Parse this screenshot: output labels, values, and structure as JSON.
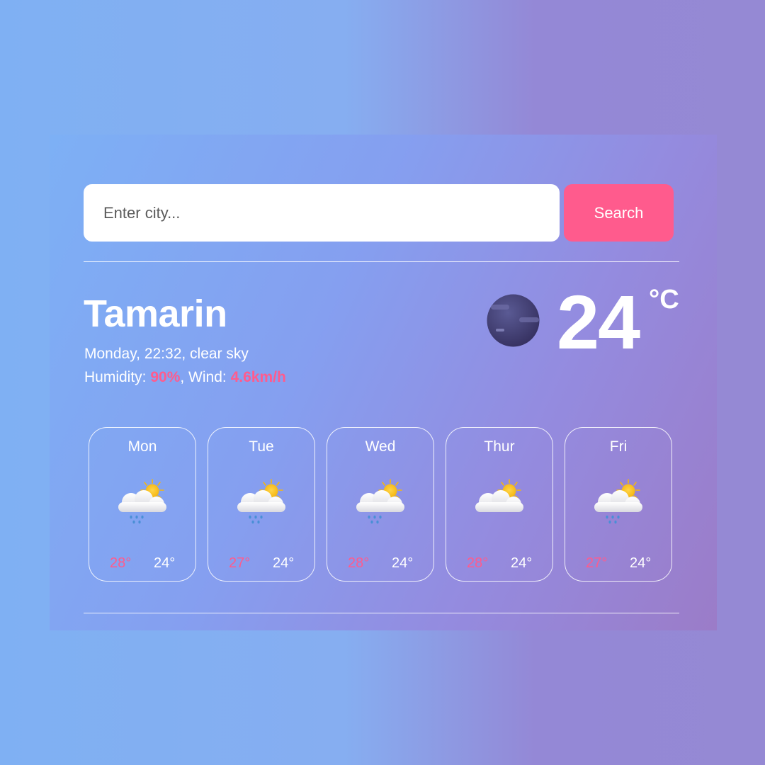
{
  "search": {
    "placeholder": "Enter city...",
    "value": "",
    "button_label": "Search"
  },
  "current": {
    "city": "Tamarin",
    "day_time_description": "Monday, 22:32, clear sky",
    "humidity_label": "Humidity: ",
    "humidity_value": "90%",
    "wind_label": ", Wind: ",
    "wind_value": "4.6km/h",
    "temperature": "24",
    "unit": "°C",
    "icon": "night-clear-moon-icon"
  },
  "forecast": [
    {
      "day": "Mon",
      "icon": "rain-cloud-sun-icon",
      "high": "28°",
      "low": "24°"
    },
    {
      "day": "Tue",
      "icon": "rain-cloud-sun-icon",
      "high": "27°",
      "low": "24°"
    },
    {
      "day": "Wed",
      "icon": "rain-cloud-sun-icon",
      "high": "28°",
      "low": "24°"
    },
    {
      "day": "Thur",
      "icon": "cloud-sun-icon",
      "high": "28°",
      "low": "24°"
    },
    {
      "day": "Fri",
      "icon": "rain-cloud-sun-icon",
      "high": "27°",
      "low": "24°"
    }
  ],
  "colors": {
    "accent": "#ff5b8d",
    "card_border": "#ffffff",
    "background_start": "#7fb0f3",
    "background_end": "#9589d4"
  }
}
